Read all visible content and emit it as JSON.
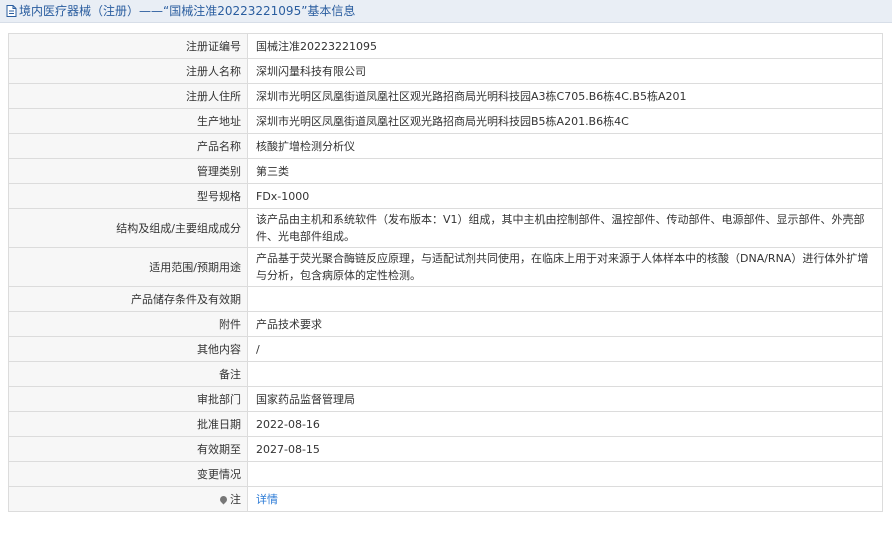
{
  "header": {
    "title": "境内医疗器械（注册）——“国械注准20223221095”基本信息"
  },
  "rows": [
    {
      "label": "注册证编号",
      "value": "国械注准20223221095"
    },
    {
      "label": "注册人名称",
      "value": "深圳闪量科技有限公司"
    },
    {
      "label": "注册人住所",
      "value": "深圳市光明区凤凰街道凤凰社区观光路招商局光明科技园A3栋C705.B6栋4C.B5栋A201"
    },
    {
      "label": "生产地址",
      "value": "深圳市光明区凤凰街道凤凰社区观光路招商局光明科技园B5栋A201.B6栋4C"
    },
    {
      "label": "产品名称",
      "value": "核酸扩增检测分析仪"
    },
    {
      "label": "管理类别",
      "value": "第三类"
    },
    {
      "label": "型号规格",
      "value": "FDx-1000"
    },
    {
      "label": "结构及组成/主要组成成分",
      "value": "该产品由主机和系统软件（发布版本：V1）组成，其中主机由控制部件、温控部件、传动部件、电源部件、显示部件、外壳部件、光电部件组成。"
    },
    {
      "label": "适用范围/预期用途",
      "value": "产品基于荧光聚合酶链反应原理，与适配试剂共同使用，在临床上用于对来源于人体样本中的核酸（DNA/RNA）进行体外扩增与分析，包含病原体的定性检测。"
    },
    {
      "label": "产品储存条件及有效期",
      "value": ""
    },
    {
      "label": "附件",
      "value": "产品技术要求"
    },
    {
      "label": "其他内容",
      "value": "/"
    },
    {
      "label": "备注",
      "value": ""
    },
    {
      "label": "审批部门",
      "value": "国家药品监督管理局"
    },
    {
      "label": "批准日期",
      "value": "2022-08-16"
    },
    {
      "label": "有效期至",
      "value": "2027-08-15"
    },
    {
      "label": "变更情况",
      "value": ""
    }
  ],
  "note": {
    "label": "注",
    "link_text": "详情"
  },
  "colors": {
    "title": "#2a5d9f",
    "link": "#2a7ad6",
    "label_bg": "#f7f7f7"
  }
}
